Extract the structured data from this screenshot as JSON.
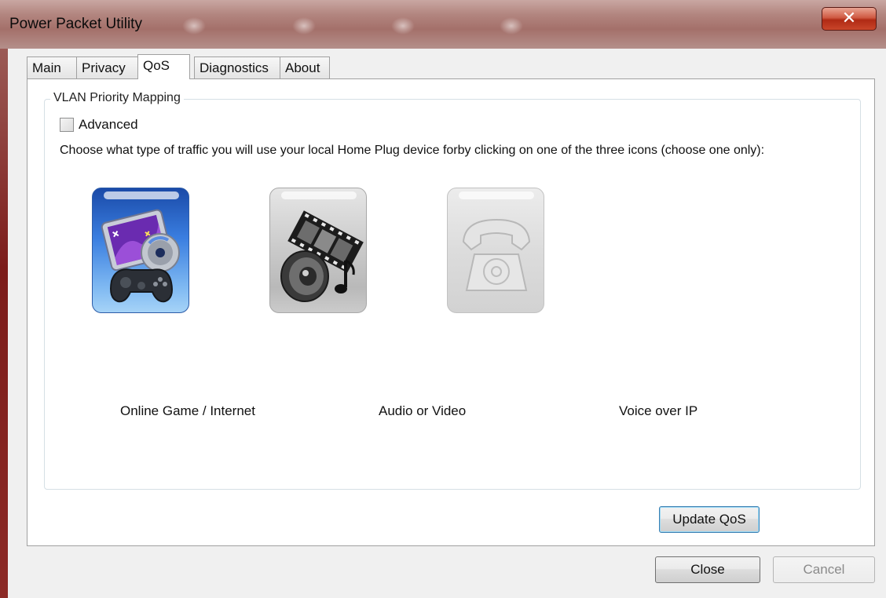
{
  "window": {
    "title": "Power Packet Utility",
    "close_glyph": "✕"
  },
  "tabs": [
    {
      "label": "Main",
      "active": false
    },
    {
      "label": "Privacy",
      "active": false
    },
    {
      "label": "QoS",
      "active": true
    },
    {
      "label": "Diagnostics",
      "active": false
    },
    {
      "label": "About",
      "active": false
    }
  ],
  "qos": {
    "group_title": "VLAN Priority Mapping",
    "advanced_label": "Advanced",
    "advanced_checked": false,
    "instructions": "Choose what type of traffic you will use your local Home Plug device forby clicking on one of the three icons (choose one only):",
    "options": [
      {
        "label": "Online Game / Internet",
        "icon": "game-internet-icon",
        "selected": true
      },
      {
        "label": "Audio or Video",
        "icon": "audio-video-icon",
        "selected": false
      },
      {
        "label": "Voice over IP",
        "icon": "telephone-icon",
        "selected": false
      }
    ],
    "update_label": "Update QoS"
  },
  "footer": {
    "close_label": "Close",
    "cancel_label": "Cancel"
  },
  "colors": {
    "titlebar": "#b2857f",
    "selected_icon": "#3a7ee0",
    "close_button": "#cf5a42"
  }
}
